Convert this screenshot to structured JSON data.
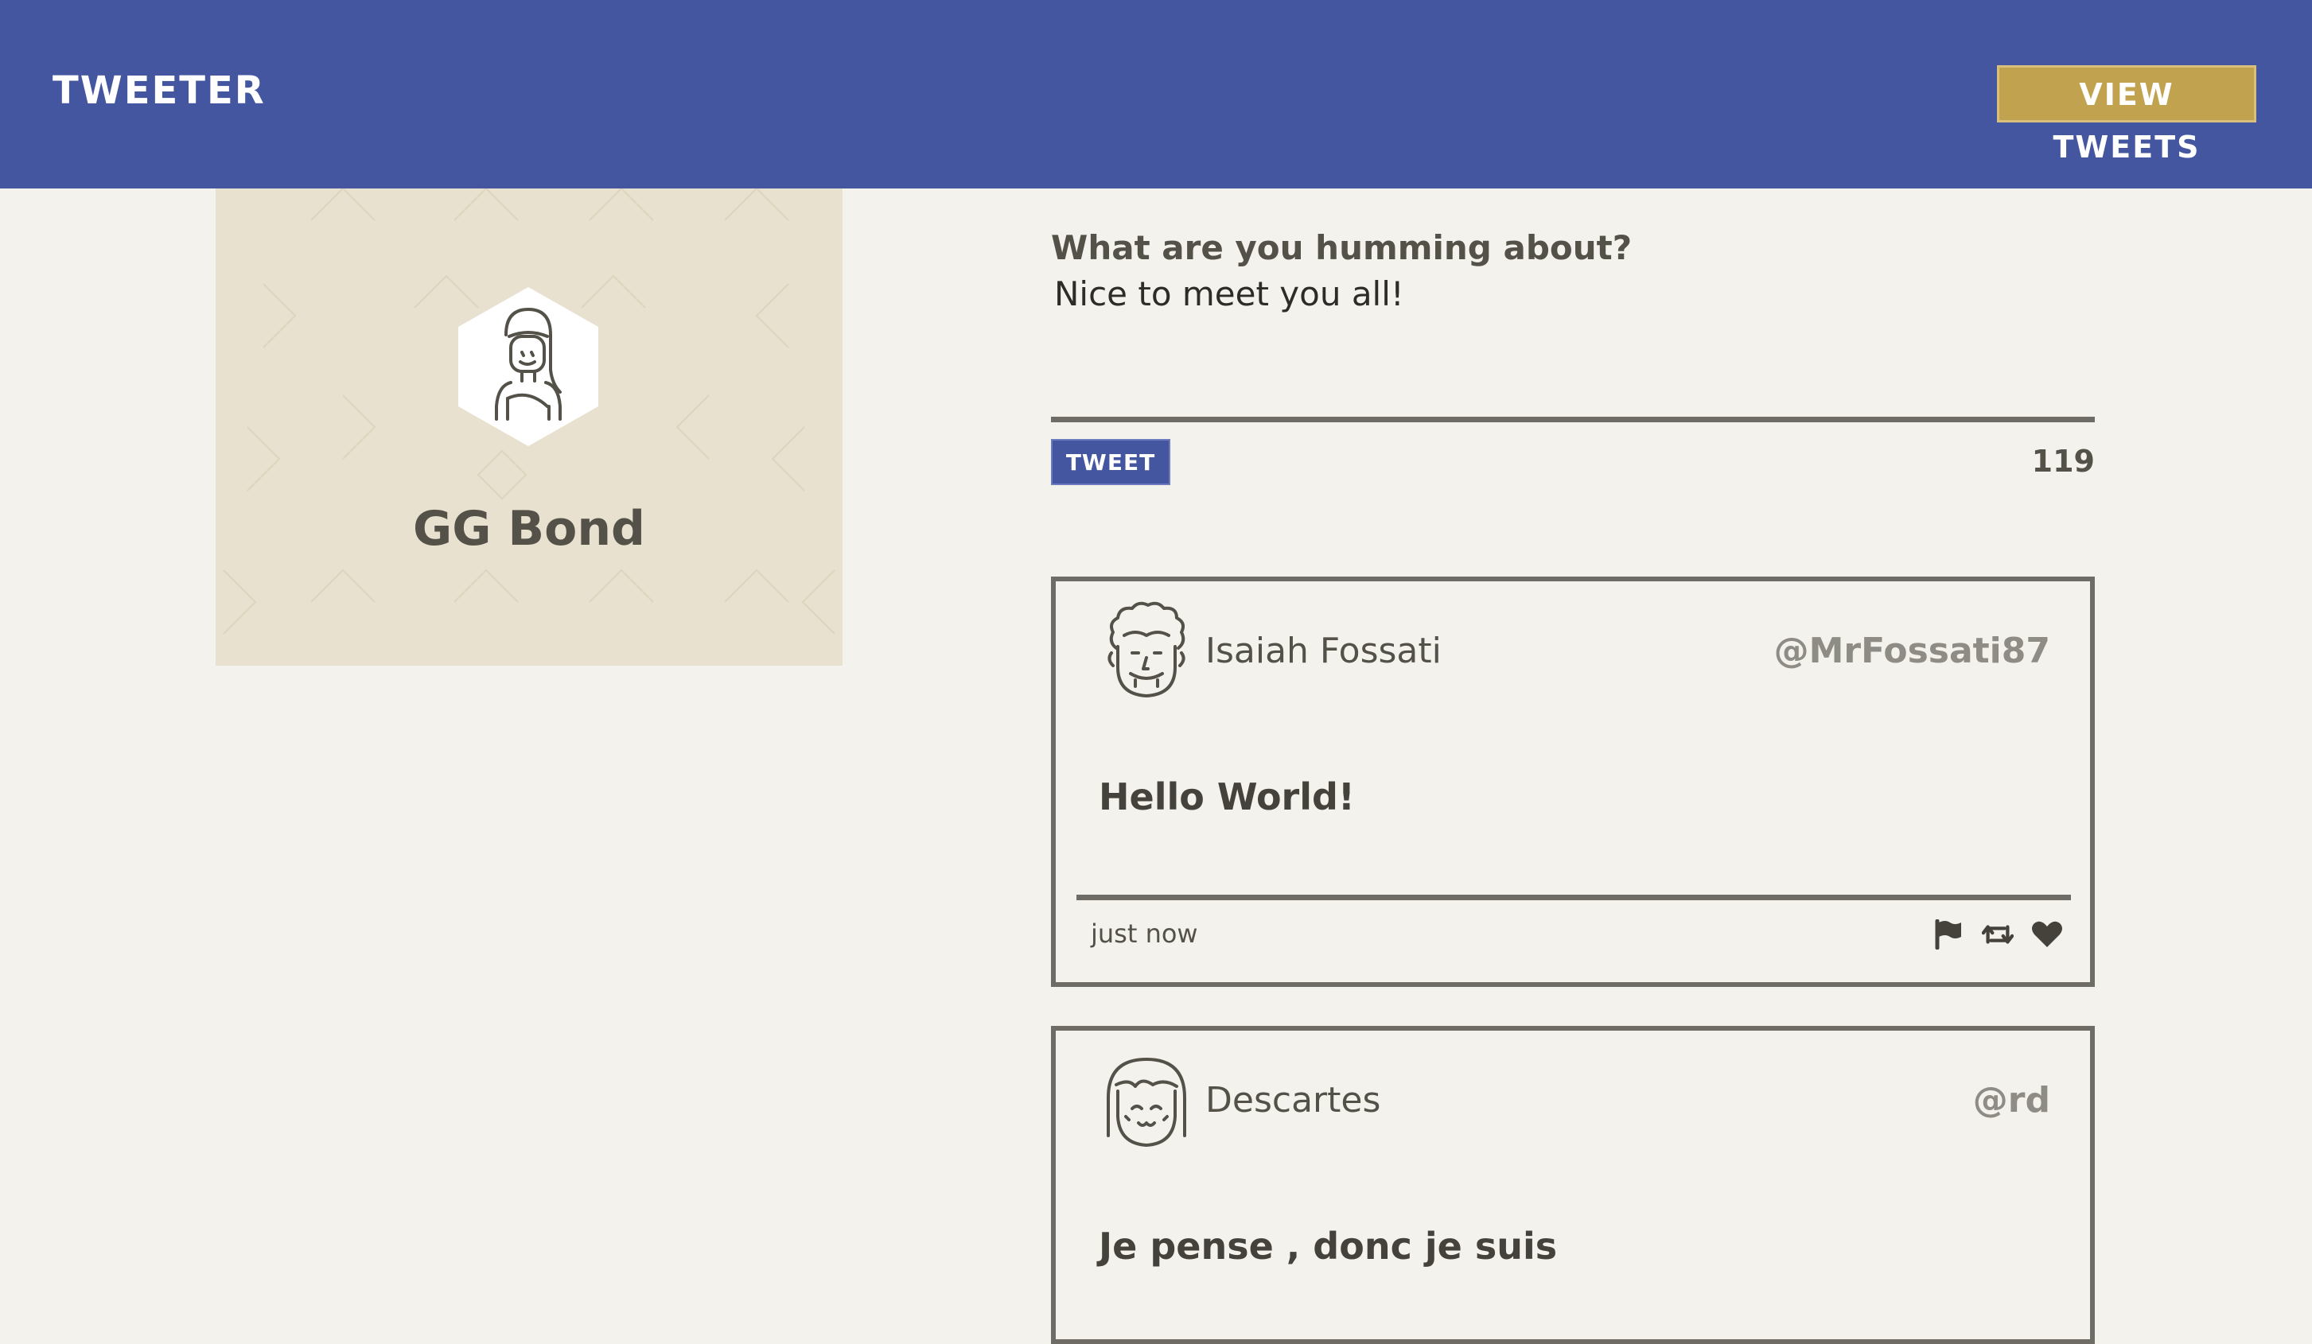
{
  "nav": {
    "brand": "TWEETER",
    "view_tweets_label": "VIEW TWEETS"
  },
  "colors": {
    "nav_bg": "#4556a0",
    "accent_gold": "#c1a24e",
    "page_bg": "#f4f2ed",
    "profile_bg": "#e8e1cf",
    "text_dark": "#545149",
    "handle_gray": "#8f8c85"
  },
  "profile": {
    "name": "GG Bond",
    "avatar_icon": "girl-avatar-icon"
  },
  "compose": {
    "label": "What are you humming about?",
    "value": "Nice to meet you all!",
    "tweet_button_label": "TWEET",
    "char_count": "119"
  },
  "tweets": [
    {
      "name": "Isaiah Fossati",
      "handle": "@MrFossati87",
      "body": "Hello World!",
      "time": "just now",
      "avatar_icon": "curly-hair-man-avatar-icon",
      "actions": [
        "flag-icon",
        "retweet-icon",
        "heart-icon"
      ]
    },
    {
      "name": "Descartes",
      "handle": "@rd",
      "body": "Je pense , donc je suis",
      "avatar_icon": "bob-hair-avatar-icon"
    }
  ]
}
